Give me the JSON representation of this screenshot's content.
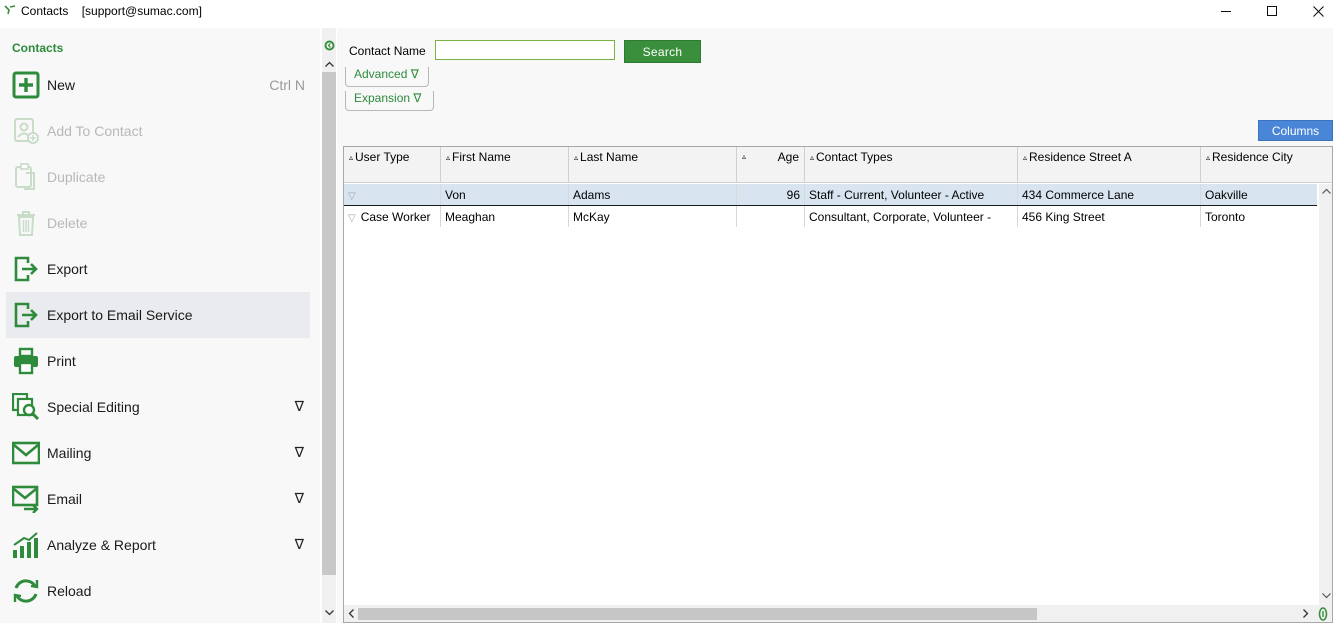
{
  "window": {
    "title": "Contacts    [support@sumac.com]",
    "accent": "#2e8b3c"
  },
  "sidebar": {
    "title": "Contacts",
    "items": [
      {
        "label": "New",
        "shortcut": "Ctrl N",
        "icon": "plus-square-icon",
        "enabled": true
      },
      {
        "label": "Add To Contact",
        "icon": "add-to-contact-icon",
        "enabled": false
      },
      {
        "label": "Duplicate",
        "icon": "duplicate-icon",
        "enabled": false
      },
      {
        "label": "Delete",
        "icon": "trash-icon",
        "enabled": false
      },
      {
        "label": "Export",
        "icon": "export-icon",
        "enabled": true
      },
      {
        "label": "Export to Email Service",
        "icon": "export-icon",
        "enabled": true
      },
      {
        "label": "Print",
        "icon": "printer-icon",
        "enabled": true
      },
      {
        "label": "Special Editing",
        "icon": "special-editing-icon",
        "enabled": true,
        "dropdown": "∇"
      },
      {
        "label": "Mailing",
        "icon": "envelope-icon",
        "enabled": true,
        "dropdown": "∇"
      },
      {
        "label": "Email",
        "icon": "email-send-icon",
        "enabled": true,
        "dropdown": "∇"
      },
      {
        "label": "Analyze & Report",
        "icon": "bar-chart-icon",
        "enabled": true,
        "dropdown": "∇"
      },
      {
        "label": "Reload",
        "icon": "reload-icon",
        "enabled": true
      }
    ]
  },
  "search": {
    "label": "Contact Name",
    "value": "",
    "button": "Search",
    "advanced": "Advanced ∇",
    "expansion": "Expansion ∇"
  },
  "grid": {
    "columns_button": "Columns",
    "headers": [
      "User Type",
      "First Name",
      "Last Name",
      "Age",
      "Contact Types",
      "Residence Street A",
      "Residence City"
    ],
    "sort_glyph": "▵",
    "row_glyph": "▽",
    "rows": [
      [
        "",
        "Von",
        "Adams",
        "96",
        "Staff - Current, Volunteer - Active",
        "434 Commerce Lane",
        "Oakville"
      ],
      [
        "Case Worker",
        "Meaghan",
        "McKay",
        "",
        "Consultant, Corporate, Volunteer -",
        "456 King Street",
        "Toronto"
      ]
    ],
    "selected_row": 0
  }
}
